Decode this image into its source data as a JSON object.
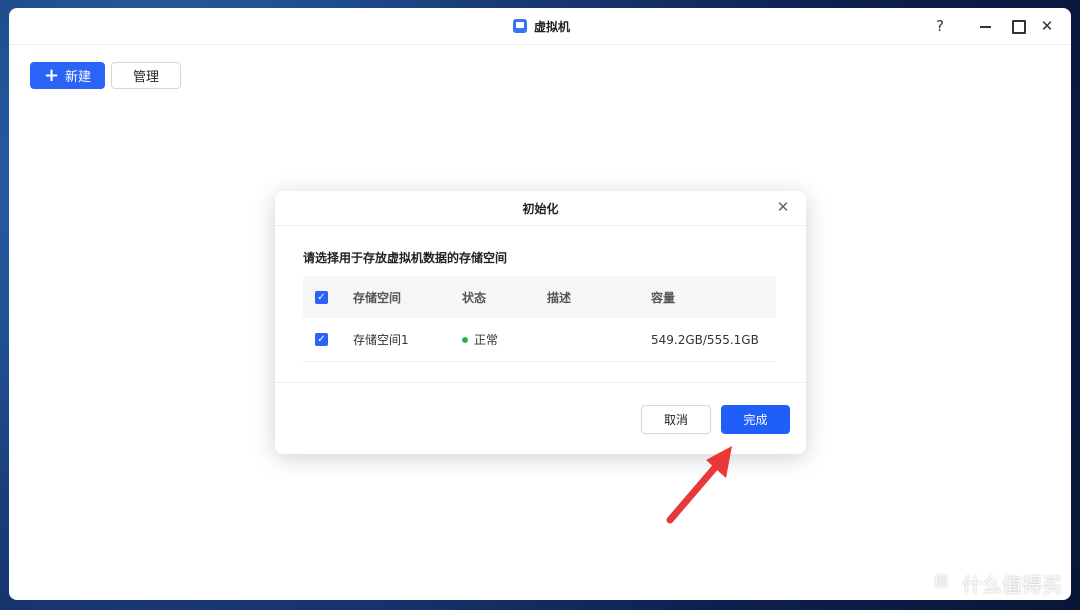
{
  "window": {
    "title": "虚拟机",
    "help_label": "?",
    "close_label": "✕"
  },
  "toolbar": {
    "new_label": "新建",
    "new_icon": "+",
    "manage_label": "管理"
  },
  "dialog": {
    "title": "初始化",
    "close_label": "✕",
    "prompt": "请选择用于存放虚拟机数据的存储空间",
    "table": {
      "headers": {
        "name": "存储空间",
        "status": "状态",
        "desc": "描述",
        "capacity": "容量"
      },
      "rows": [
        {
          "name": "存储空间1",
          "status": "正常",
          "desc": "",
          "capacity": "549.2GB/555.1GB",
          "checked": true
        }
      ]
    },
    "cancel_label": "取消",
    "done_label": "完成"
  },
  "watermark": {
    "text": "什么值得买",
    "icon": "值"
  },
  "colors": {
    "primary": "#2b63f6",
    "status_ok": "#27b14a",
    "arrow": "#e8383a"
  }
}
